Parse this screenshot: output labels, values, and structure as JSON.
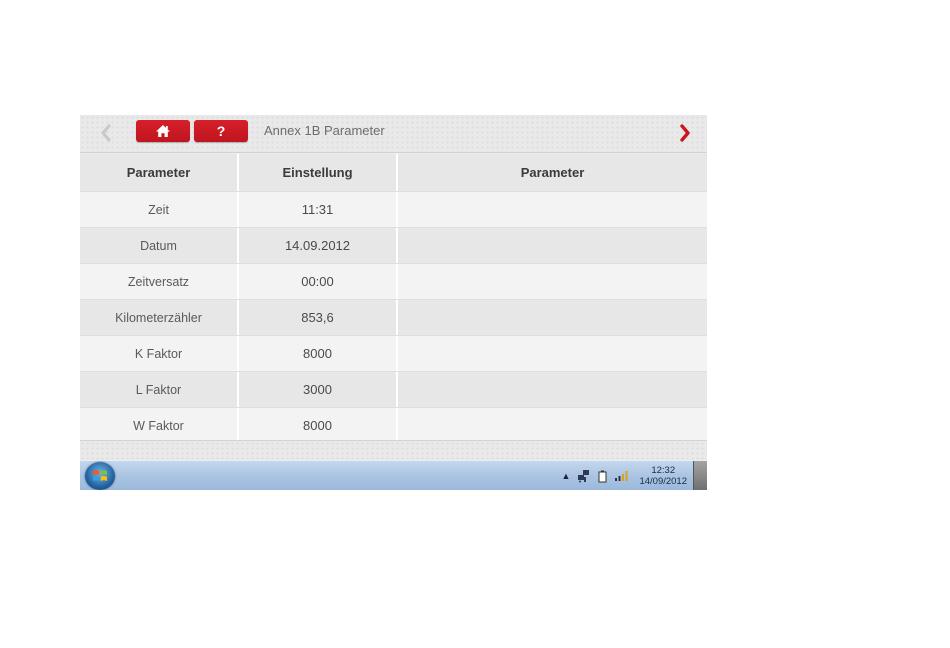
{
  "header": {
    "title": "Annex 1B Parameter",
    "home_icon": "home-icon",
    "help_label": "?",
    "back_icon": "chevron-left-icon",
    "forward_icon": "chevron-right-icon"
  },
  "table": {
    "columns": [
      "Parameter",
      "Einstellung",
      "Parameter"
    ],
    "rows": [
      {
        "label": "Zeit",
        "value": "11:31"
      },
      {
        "label": "Datum",
        "value": "14.09.2012"
      },
      {
        "label": "Zeitversatz",
        "value": "00:00"
      },
      {
        "label": "Kilometerzähler",
        "value": "853,6"
      },
      {
        "label": "K Faktor",
        "value": "8000"
      },
      {
        "label": "L Faktor",
        "value": "3000"
      },
      {
        "label": "W Faktor",
        "value": "8000"
      }
    ]
  },
  "taskbar": {
    "clock_time": "12:32",
    "clock_date": "14/09/2012"
  },
  "colors": {
    "accent_red": "#c8171f",
    "taskbar_blue": "#a9c3e2"
  }
}
